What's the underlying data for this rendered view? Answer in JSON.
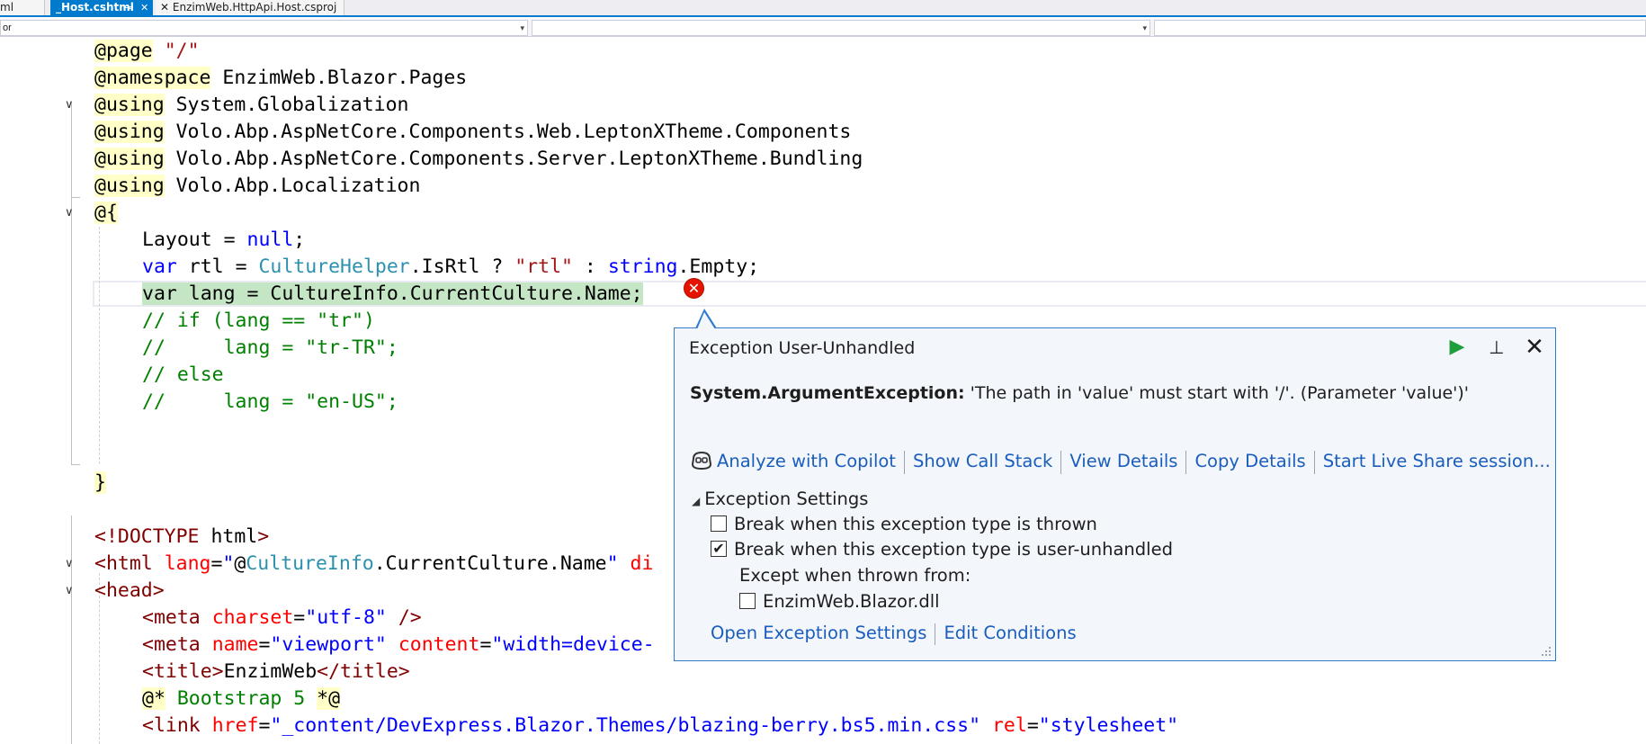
{
  "tabs": [
    {
      "label": "ml",
      "active": false
    },
    {
      "label": "_Host.cshtml",
      "active": true,
      "pin_glyph": "⊸",
      "close_glyph": "✕"
    },
    {
      "label": "EnzimWeb.HttpApi.Host.csproj",
      "active": false,
      "close_glyph": "✕"
    }
  ],
  "navbar": {
    "combo1_value": "or",
    "combo2_value": "",
    "combo3_value": "",
    "arrow": "▾"
  },
  "editor": {
    "lines": [
      {
        "indent": 0,
        "tokens": [
          {
            "c": "kw-dir",
            "t": "@page"
          },
          {
            "c": "",
            "t": " "
          },
          {
            "c": "st",
            "t": "\"/\""
          }
        ]
      },
      {
        "indent": 0,
        "tokens": [
          {
            "c": "kw-dir",
            "t": "@namespace"
          },
          {
            "c": "",
            "t": " EnzimWeb.Blazor.Pages"
          }
        ]
      },
      {
        "indent": 0,
        "fold": true,
        "tokens": [
          {
            "c": "kw-dir",
            "t": "@using"
          },
          {
            "c": "",
            "t": " System.Globalization"
          }
        ]
      },
      {
        "indent": 0,
        "tokens": [
          {
            "c": "kw-dir",
            "t": "@using"
          },
          {
            "c": "",
            "t": " Volo.Abp.AspNetCore.Components.Web.LeptonXTheme.Components"
          }
        ]
      },
      {
        "indent": 0,
        "tokens": [
          {
            "c": "kw-dir",
            "t": "@using"
          },
          {
            "c": "",
            "t": " Volo.Abp.AspNetCore.Components.Server.LeptonXTheme.Bundling"
          }
        ]
      },
      {
        "indent": 0,
        "tokens": [
          {
            "c": "kw-dir",
            "t": "@using"
          },
          {
            "c": "",
            "t": " Volo.Abp.Localization"
          }
        ]
      },
      {
        "indent": 0,
        "fold": true,
        "tokens": [
          {
            "c": "kw-dir",
            "t": "@{"
          }
        ]
      },
      {
        "indent": 1,
        "tokens": [
          {
            "c": "",
            "t": "Layout = "
          },
          {
            "c": "kw",
            "t": "null"
          },
          {
            "c": "",
            "t": ";"
          }
        ]
      },
      {
        "indent": 1,
        "tokens": [
          {
            "c": "kw",
            "t": "var"
          },
          {
            "c": "",
            "t": " rtl = "
          },
          {
            "c": "ty",
            "t": "CultureHelper"
          },
          {
            "c": "",
            "t": ".IsRtl ? "
          },
          {
            "c": "st",
            "t": "\"rtl\""
          },
          {
            "c": "",
            "t": " : "
          },
          {
            "c": "kw",
            "t": "string"
          },
          {
            "c": "",
            "t": ".Empty;"
          }
        ]
      },
      {
        "indent": 1,
        "current": true,
        "tokens": [
          {
            "c": "hl",
            "t": "var lang = CultureInfo.CurrentCulture.Name;"
          }
        ]
      },
      {
        "indent": 1,
        "tokens": [
          {
            "c": "cm",
            "t": "// if (lang == \"tr\")"
          }
        ]
      },
      {
        "indent": 1,
        "tokens": [
          {
            "c": "cm",
            "t": "//     lang = \"tr-TR\";"
          }
        ]
      },
      {
        "indent": 1,
        "tokens": [
          {
            "c": "cm",
            "t": "// else"
          }
        ]
      },
      {
        "indent": 1,
        "tokens": [
          {
            "c": "cm",
            "t": "//     lang = \"en-US\";"
          }
        ]
      },
      {
        "indent": 0,
        "tokens": []
      },
      {
        "indent": 0,
        "tokens": []
      },
      {
        "indent": 0,
        "tokens": [
          {
            "c": "kw-dir",
            "t": "}"
          }
        ]
      },
      {
        "indent": 0,
        "tokens": []
      },
      {
        "indent": 0,
        "tokens": [
          {
            "c": "tg",
            "t": "<!DOCTYPE"
          },
          {
            "c": "",
            "t": " html"
          },
          {
            "c": "tg",
            "t": ">"
          }
        ]
      },
      {
        "indent": 0,
        "fold": true,
        "tokens": [
          {
            "c": "tg",
            "t": "<html"
          },
          {
            "c": "",
            "t": " "
          },
          {
            "c": "at",
            "t": "lang"
          },
          {
            "c": "",
            "t": "="
          },
          {
            "c": "av",
            "t": "\""
          },
          {
            "c": "",
            "t": "@"
          },
          {
            "c": "ty",
            "t": "CultureInfo"
          },
          {
            "c": "",
            "t": ".CurrentCulture.Name"
          },
          {
            "c": "av",
            "t": "\""
          },
          {
            "c": "",
            "t": " "
          },
          {
            "c": "at",
            "t": "di"
          }
        ]
      },
      {
        "indent": 0,
        "fold": true,
        "tokens": [
          {
            "c": "tg",
            "t": "<head>"
          }
        ]
      },
      {
        "indent": 1,
        "tokens": [
          {
            "c": "tg",
            "t": "<meta"
          },
          {
            "c": "",
            "t": " "
          },
          {
            "c": "at",
            "t": "charset"
          },
          {
            "c": "",
            "t": "="
          },
          {
            "c": "av",
            "t": "\"utf-8\""
          },
          {
            "c": "",
            "t": " "
          },
          {
            "c": "tg",
            "t": "/>"
          }
        ]
      },
      {
        "indent": 1,
        "tokens": [
          {
            "c": "tg",
            "t": "<meta"
          },
          {
            "c": "",
            "t": " "
          },
          {
            "c": "at",
            "t": "name"
          },
          {
            "c": "",
            "t": "="
          },
          {
            "c": "av",
            "t": "\"viewport\""
          },
          {
            "c": "",
            "t": " "
          },
          {
            "c": "at",
            "t": "content"
          },
          {
            "c": "",
            "t": "="
          },
          {
            "c": "av",
            "t": "\"width=device-"
          }
        ]
      },
      {
        "indent": 1,
        "tokens": [
          {
            "c": "tg",
            "t": "<title>"
          },
          {
            "c": "",
            "t": "EnzimWeb"
          },
          {
            "c": "tg",
            "t": "</title>"
          }
        ]
      },
      {
        "indent": 1,
        "tokens": [
          {
            "c": "kw-dir",
            "t": "@*"
          },
          {
            "c": "cm",
            "t": " Bootstrap 5 "
          },
          {
            "c": "kw-dir",
            "t": "*@"
          }
        ]
      },
      {
        "indent": 1,
        "tokens": [
          {
            "c": "tg",
            "t": "<link"
          },
          {
            "c": "",
            "t": " "
          },
          {
            "c": "at",
            "t": "href"
          },
          {
            "c": "",
            "t": "="
          },
          {
            "c": "av",
            "t": "\"_content/DevExpress.Blazor.Themes/blazing-berry.bs5.min.css\""
          },
          {
            "c": "",
            "t": " "
          },
          {
            "c": "at",
            "t": "rel"
          },
          {
            "c": "",
            "t": "="
          },
          {
            "c": "av",
            "t": "\"stylesheet\""
          }
        ]
      }
    ],
    "error_glyph": "✕"
  },
  "popup": {
    "title": "Exception User-Unhandled",
    "run_glyph": "▶",
    "pin_glyph": "⊥",
    "close_glyph": "✕",
    "exception_type": "System.ArgumentException:",
    "exception_message": " 'The path in 'value' must start with '/'. (Parameter 'value')'",
    "links": [
      "Analyze with Copilot",
      "Show Call Stack",
      "View Details",
      "Copy Details",
      "Start Live Share session..."
    ],
    "settings_header": "Exception Settings",
    "settings_triangle": "◢",
    "break_thrown": {
      "label": "Break when this exception type is thrown",
      "checked": false
    },
    "break_unhandled": {
      "label": "Break when this exception type is user-unhandled",
      "checked": true,
      "mark": "✔"
    },
    "except_label": "Except when thrown from:",
    "except_dll": {
      "label": "EnzimWeb.Blazor.dll",
      "checked": false
    },
    "footer_links": [
      "Open Exception Settings",
      "Edit Conditions"
    ]
  },
  "colors": {
    "accent": "#007acc",
    "popup_border": "#2e7bcf",
    "link": "#1a5dbd",
    "error": "#e51400",
    "run": "#1e9e3c"
  }
}
